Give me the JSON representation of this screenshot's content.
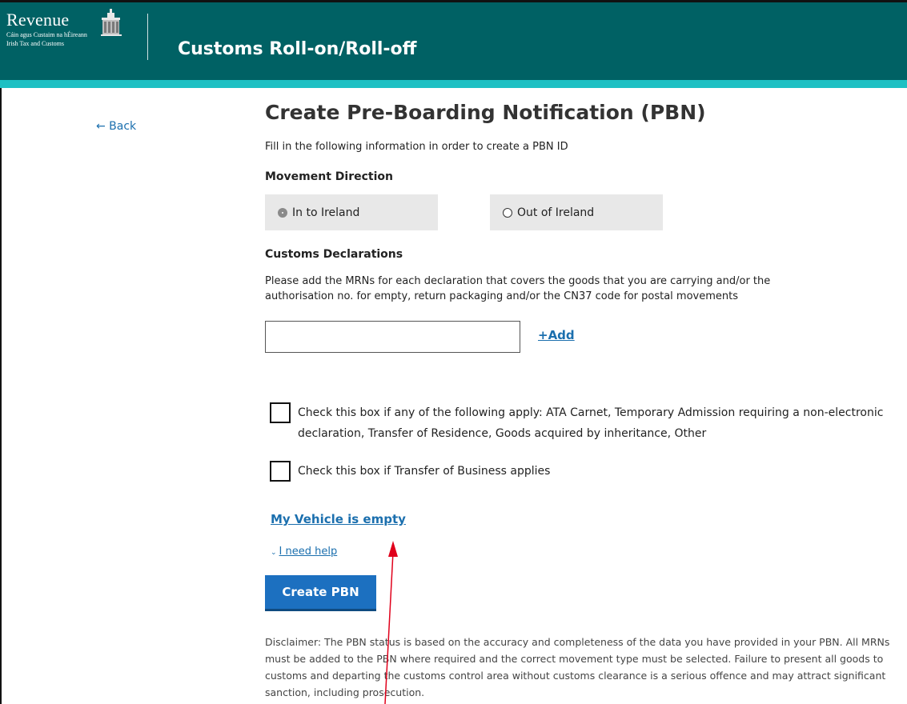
{
  "header": {
    "logo_word": "Revenue",
    "logo_line1": "Cáin agus Custaim na hÉireann",
    "logo_line2": "Irish Tax and Customs",
    "app_title": "Customs Roll-on/Roll-off"
  },
  "nav": {
    "back_label": "← Back"
  },
  "page": {
    "title": "Create Pre-Boarding Notification (PBN)",
    "intro": "Fill in the following information in order to create a PBN ID"
  },
  "movement": {
    "label": "Movement Direction",
    "options": [
      {
        "label": "In to Ireland",
        "selected": true
      },
      {
        "label": "Out of Ireland",
        "selected": false
      }
    ]
  },
  "declarations": {
    "label": "Customs Declarations",
    "description": "Please add the MRNs for each declaration that covers the goods that you are carrying and/or the authorisation no. for empty, return packaging and/or the CN37 code for postal movements",
    "mrn_value": "",
    "add_label": "+Add"
  },
  "checkboxes": [
    {
      "label": "Check this box if any of the following apply: ATA Carnet, Temporary Admission requiring a non-electronic declaration, Transfer of Residence, Goods acquired by inheritance, Other",
      "checked": false
    },
    {
      "label": "Check this box if Transfer of Business applies",
      "checked": false
    }
  ],
  "actions": {
    "vehicle_empty": "My Vehicle is empty",
    "help": "I need help",
    "create": "Create PBN"
  },
  "disclaimer": "Disclaimer: The PBN status is based on the accuracy and completeness of the data you have provided in your PBN. All MRNs must be added to the PBN where required and the correct movement type must be selected. Failure to present all goods to customs and departing the customs control area without customs clearance is a serious offence and may attract significant sanction, including prosecution.",
  "colors": {
    "header_bg": "#006164",
    "header_stripe": "#1ec0c3",
    "link": "#1b6fae",
    "primary_button": "#1c70c0",
    "annotation_arrow": "#e0001b"
  }
}
